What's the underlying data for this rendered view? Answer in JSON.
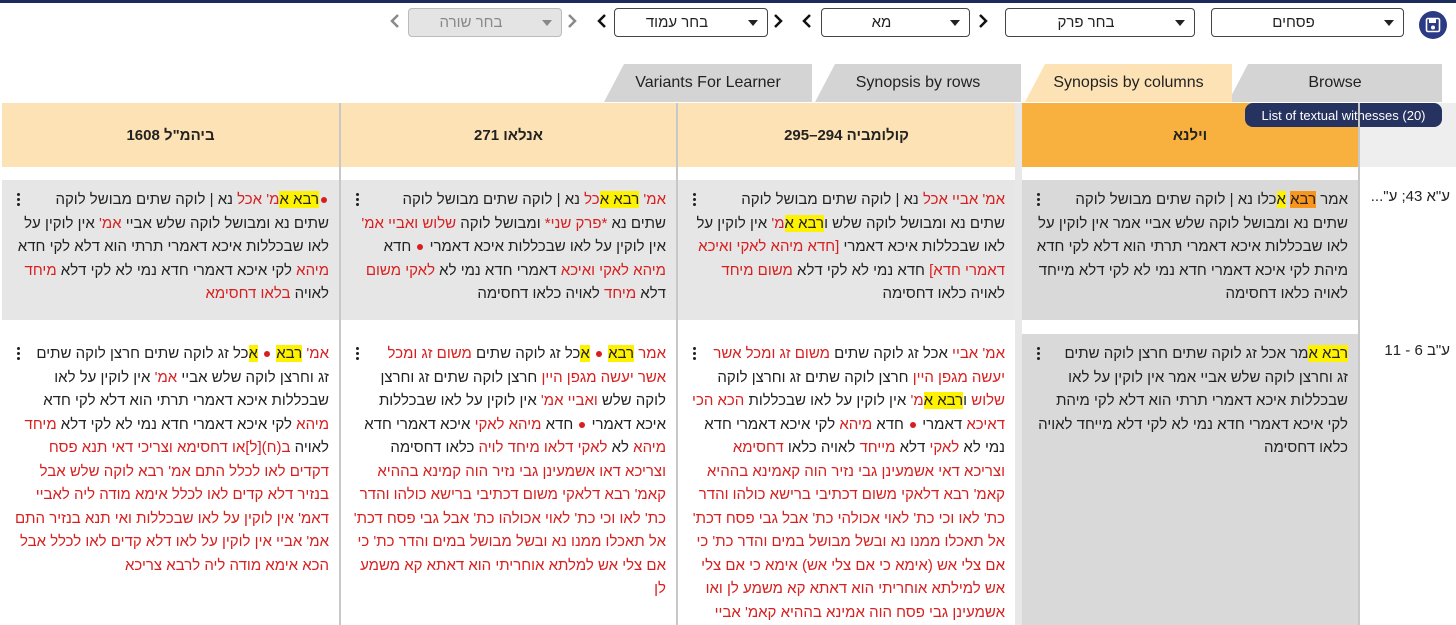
{
  "toolbar": {
    "tractate": "פסחים",
    "chapter_placeholder": "בחר פרק",
    "page": "מא",
    "amud_placeholder": "בחר עמוד",
    "line_placeholder": "בחר שורה"
  },
  "tabs": [
    "Browse",
    "Synopsis by columns",
    "Synopsis by rows",
    "Variants For Learner"
  ],
  "witness_badge": "List of textual witnesses (20)",
  "columns": [
    "וילנא",
    "קולומביה 294–295",
    "אנלאו 271",
    "ביהמ\"ל 1608"
  ],
  "row_refs": [
    "ע\"א 43; ע\"...",
    "ע\"ב 6 - 11"
  ],
  "colors": {
    "accent": "#2a3b84",
    "main_header": "#f8b03f",
    "header": "#fde2b5",
    "variant": "#d81f1f",
    "highlight": "#fff200"
  }
}
